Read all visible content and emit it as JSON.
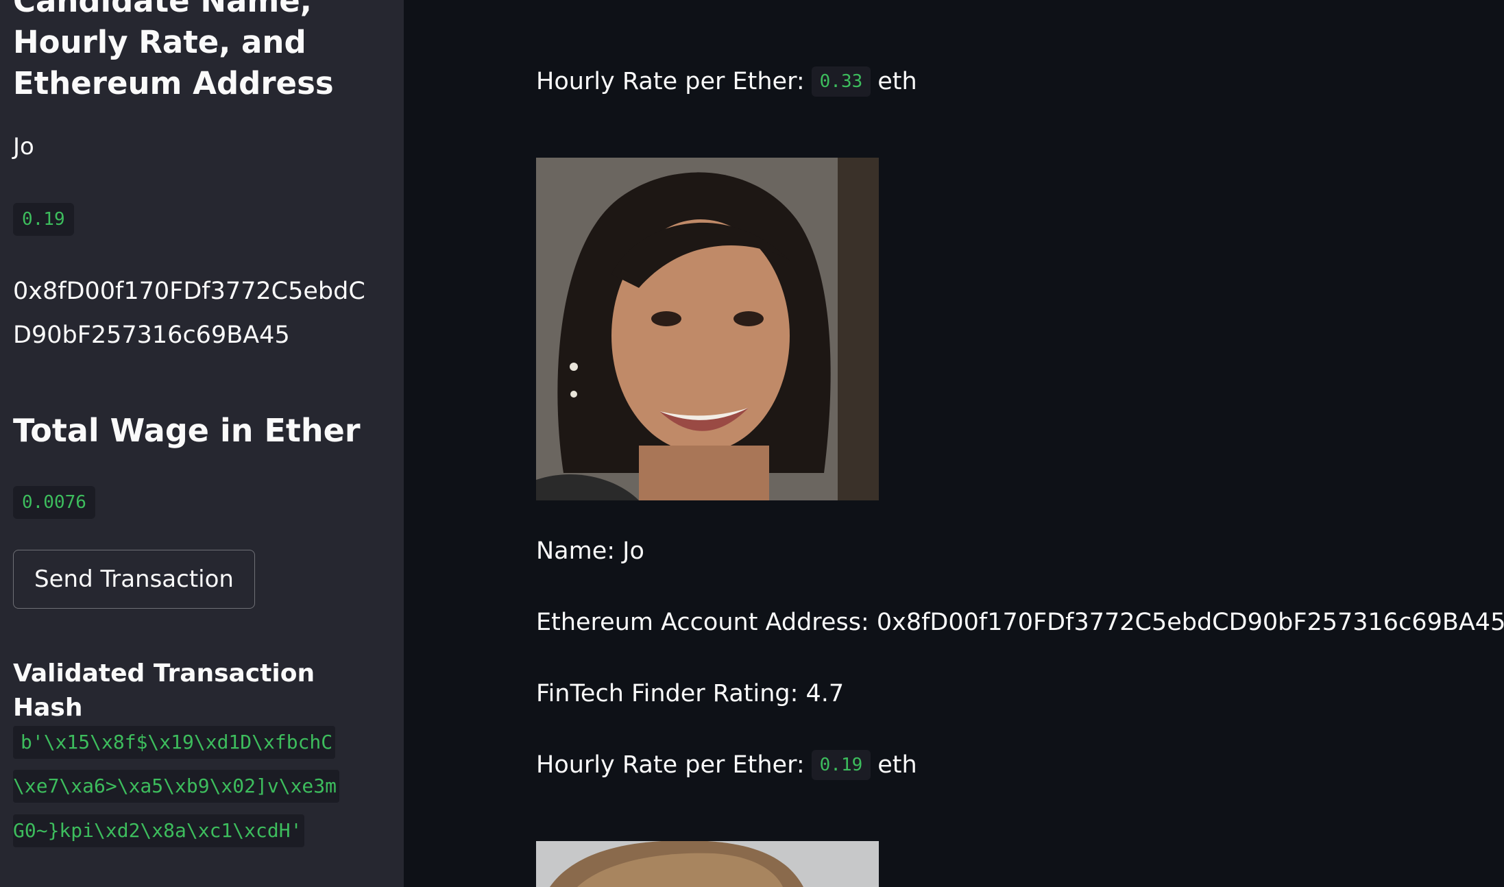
{
  "sidebar": {
    "heading": "Candidate Name, Hourly Rate, and Ethereum Address",
    "candidate_name": "Jo",
    "hourly_rate": "0.19",
    "address": "0x8fD00f170FDf3772C5ebdCD90bF257316c69BA45",
    "total_wage_heading": "Total Wage in Ether",
    "total_wage": "0.0076",
    "send_button": "Send Transaction",
    "hash_heading": "Validated Transaction Hash",
    "hash_lines": [
      "b'\\x15\\x8f$\\x19\\xd1D\\xfbchC",
      "\\xe7\\xa6>\\xa5\\xb9\\x02]v\\xe3m",
      "G0~}kpi\\xd2\\x8a\\xc1\\xcdH'"
    ]
  },
  "main": {
    "previous_rate": {
      "label": "Hourly Rate per Ether:",
      "value": "0.33",
      "unit": "eth"
    },
    "candidate": {
      "name_line": "Name: Jo",
      "address_line": "Ethereum Account Address: 0x8fD00f170FDf3772C5ebdCD90bF257316c69BA45",
      "rating_line": "FinTech Finder Rating: 4.7",
      "rate": {
        "label": "Hourly Rate per Ether:",
        "value": "0.19",
        "unit": "eth"
      }
    }
  },
  "colors": {
    "background": "#0e1117",
    "sidebar": "#262730",
    "code_text": "#3dbd5d",
    "text": "#fafafa"
  }
}
